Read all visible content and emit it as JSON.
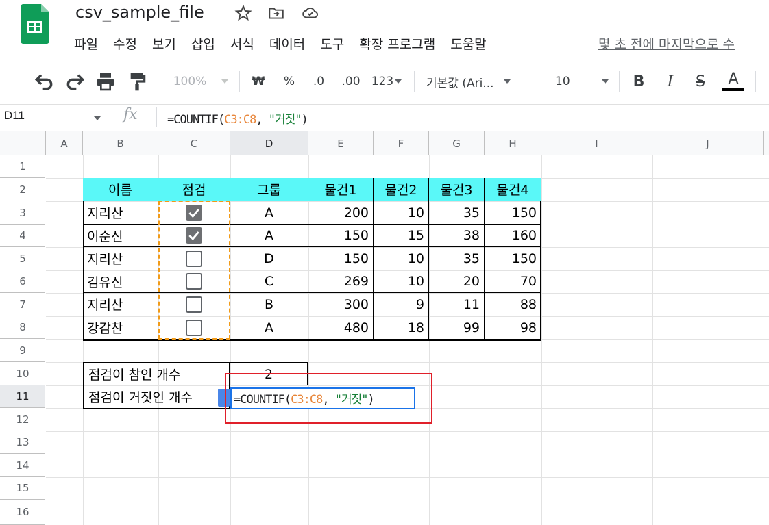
{
  "app": {
    "doc_title": "csv_sample_file",
    "last_edit": "몇 초 전에 마지막으로 수"
  },
  "menu": [
    "파일",
    "수정",
    "보기",
    "삽입",
    "서식",
    "데이터",
    "도구",
    "확장 프로그램",
    "도움말"
  ],
  "toolbar": {
    "zoom": "100%",
    "currency": "₩",
    "percent": "%",
    "decrease_decimal": ".0",
    "increase_decimal": ".00",
    "number_format": "123",
    "font": "기본값 (Ari...",
    "font_size": "10",
    "bold": "B",
    "italic": "I",
    "strike": "S",
    "text_color": "A"
  },
  "formula_bar": {
    "name_box": "D11",
    "fx": "fx",
    "formula_parts": [
      "=COUNTIF(",
      "C3:C8",
      ", ",
      "\"거짓\"",
      ")"
    ]
  },
  "columns": [
    "A",
    "B",
    "C",
    "D",
    "E",
    "F",
    "G",
    "H",
    "I",
    "J"
  ],
  "selected_column": "D",
  "rows": [
    "1",
    "2",
    "3",
    "4",
    "5",
    "6",
    "7",
    "8",
    "9",
    "10",
    "11",
    "12",
    "13",
    "14",
    "15",
    "16"
  ],
  "selected_row": "11",
  "table": {
    "headers": [
      "이름",
      "점검",
      "그룹",
      "물건1",
      "물건2",
      "물건3",
      "물건4"
    ],
    "rows": [
      {
        "name": "지리산",
        "checked": true,
        "group": "A",
        "v1": "200",
        "v2": "10",
        "v3": "35",
        "v4": "150"
      },
      {
        "name": "이순신",
        "checked": true,
        "group": "A",
        "v1": "150",
        "v2": "15",
        "v3": "38",
        "v4": "160"
      },
      {
        "name": "지리산",
        "checked": false,
        "group": "D",
        "v1": "150",
        "v2": "10",
        "v3": "35",
        "v4": "150"
      },
      {
        "name": "김유신",
        "checked": false,
        "group": "C",
        "v1": "269",
        "v2": "10",
        "v3": "20",
        "v4": "70"
      },
      {
        "name": "지리산",
        "checked": false,
        "group": "B",
        "v1": "300",
        "v2": "9",
        "v3": "11",
        "v4": "88"
      },
      {
        "name": "강감찬",
        "checked": false,
        "group": "A",
        "v1": "480",
        "v2": "18",
        "v3": "99",
        "v4": "98"
      }
    ]
  },
  "summary": {
    "true_label": "점검이 참인 개수",
    "true_value": "2",
    "false_label": "점검이 거짓인 개수"
  },
  "active_cell": {
    "ref": "D11",
    "formula_parts": [
      "=COUNTIF(",
      "C3:C8",
      ", ",
      "\"거짓\"",
      ")"
    ]
  },
  "colors": {
    "header_fill": "#5af8f8",
    "range_dash": "#f29b18",
    "highlight": "#e0202a",
    "active": "#1a73e8"
  }
}
